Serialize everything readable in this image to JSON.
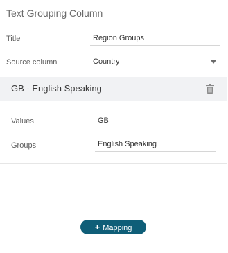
{
  "panel": {
    "title": "Text Grouping Column"
  },
  "settings": {
    "title_label": "Title",
    "title_value": "Region Groups",
    "source_label": "Source column",
    "source_value": "Country"
  },
  "group": {
    "header": "GB - English Speaking",
    "values_label": "Values",
    "values_value": "GB",
    "groups_label": "Groups",
    "groups_value": "English Speaking"
  },
  "actions": {
    "add_mapping_plus": "+",
    "add_mapping_label": "Mapping"
  },
  "icons": {
    "delete": "trash-icon",
    "dropdown": "chevron-down-icon",
    "add": "plus-icon"
  },
  "colors": {
    "accent": "#0f5e78",
    "group_header_bg": "#f1f2f4"
  }
}
